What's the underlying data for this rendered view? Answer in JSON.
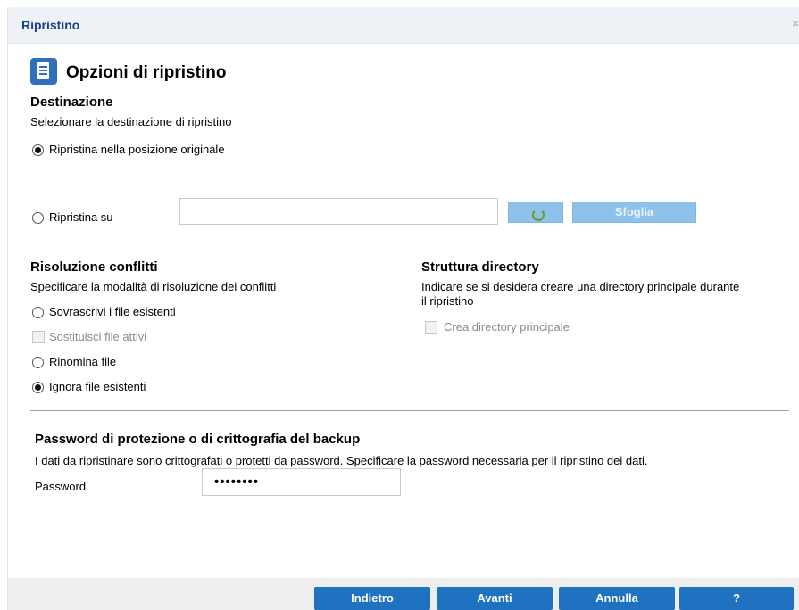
{
  "window": {
    "title": "Ripristino",
    "close_glyph": "×",
    "close_icon": "close-icon"
  },
  "header": {
    "icon": "document-list-icon",
    "title": "Opzioni di ripristino"
  },
  "destination": {
    "title": "Destinazione",
    "description": "Selezionare la destinazione di ripristino",
    "option_original": "Ripristina nella posizione originale",
    "option_original_checked": true,
    "option_to": "Ripristina su",
    "option_to_checked": false,
    "path_value": "",
    "refresh_icon": "refresh-icon",
    "browse_label": "Sfoglia"
  },
  "conflicts": {
    "title": "Risoluzione conflitti",
    "description": "Specificare la modalità di risoluzione dei conflitti",
    "overwrite": "Sovrascrivi i file esistenti",
    "replace_active": "Sostituisci file attivi",
    "rename": "Rinomina file",
    "skip": "Ignora file esistenti",
    "selected": "skip"
  },
  "directory": {
    "title": "Struttura directory",
    "description_line1": "Indicare se si desidera creare una directory principale durante",
    "description_line2": "il ripristino",
    "create_root": "Crea directory principale"
  },
  "password": {
    "title": "Password di protezione o di crittografia del backup",
    "description": "I dati da ripristinare sono crittografati o protetti da password. Specificare la password necessaria per il ripristino dei dati.",
    "label": "Password",
    "masked_value": "••••••••"
  },
  "footer": {
    "back": "Indietro",
    "next": "Avanti",
    "cancel": "Annulla",
    "help": "?"
  },
  "colors": {
    "title_text": "#1c3f8c",
    "button_primary": "#1f72bf",
    "button_disabled": "#8ec2ea"
  }
}
